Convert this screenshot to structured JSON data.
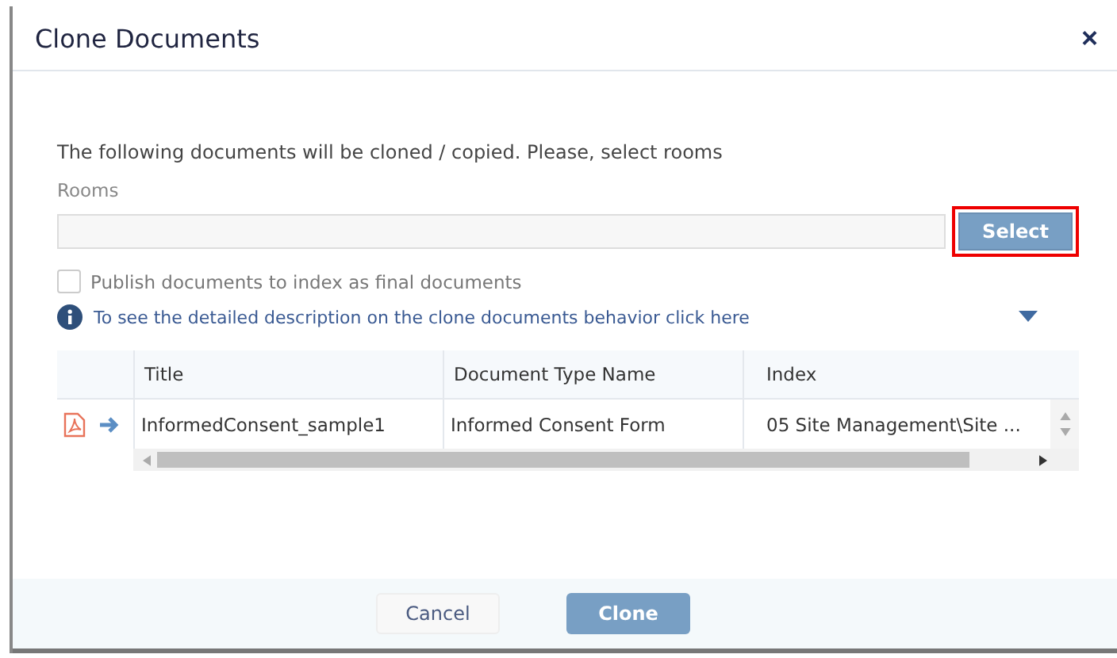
{
  "dialog": {
    "title": "Clone Documents",
    "close": "×"
  },
  "intro": "The following documents will be cloned / copied. Please, select rooms",
  "rooms": {
    "label": "Rooms",
    "button": {
      "label": "Select",
      "highlighted": true
    }
  },
  "publish": {
    "label": "Publish documents to index as final documents",
    "checked": false
  },
  "info": {
    "text": "To see the detailed description on the clone documents behavior click here",
    "expanded": false
  },
  "table": {
    "columns": [
      "Title",
      "Document Type Name",
      "Index"
    ],
    "rows": [
      {
        "cells": [
          "InformedConsent_sample1",
          "Informed Consent Form",
          "05 Site Management\\Site ..."
        ]
      }
    ]
  },
  "buttons": [
    {
      "label": "Cancel",
      "kind": "secondary"
    },
    {
      "label": "Clone",
      "kind": "primary"
    }
  ]
}
